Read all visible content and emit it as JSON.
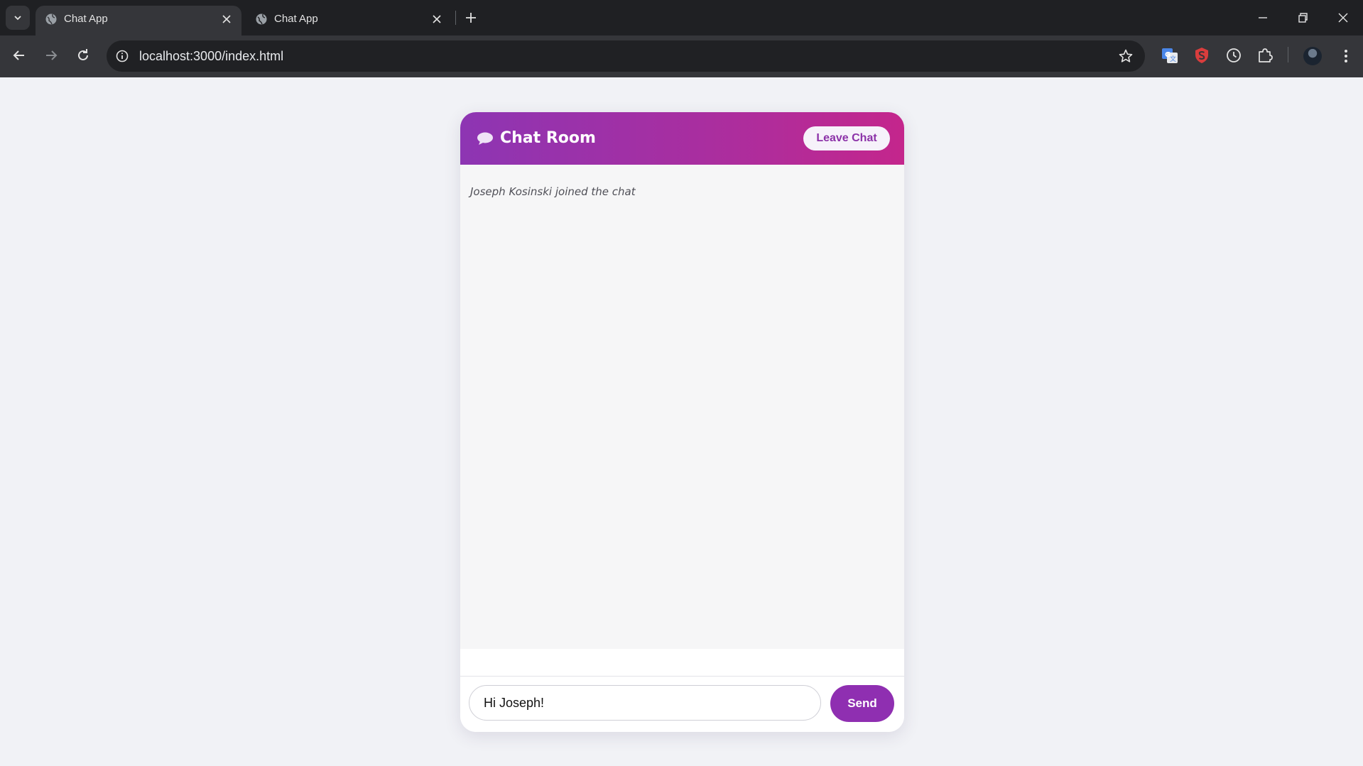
{
  "browser": {
    "tabs": [
      {
        "title": "Chat App",
        "active": true
      },
      {
        "title": "Chat App",
        "active": false
      }
    ],
    "url": "localhost:3000/index.html",
    "extensions": [
      "translate-icon",
      "shield-extension-icon",
      "history-clock-icon",
      "puzzle-extensions-icon"
    ]
  },
  "chat": {
    "title": "Chat Room",
    "leave_label": "Leave Chat",
    "messages": [
      {
        "type": "system",
        "text": "Joseph Kosinski joined the chat"
      }
    ],
    "input_value": "Hi Joseph!",
    "send_label": "Send"
  },
  "colors": {
    "header_gradient_start": "#8d35b3",
    "header_gradient_end": "#c4268c",
    "accent": "#8f2fb1",
    "page_background": "#f1f2f6"
  }
}
